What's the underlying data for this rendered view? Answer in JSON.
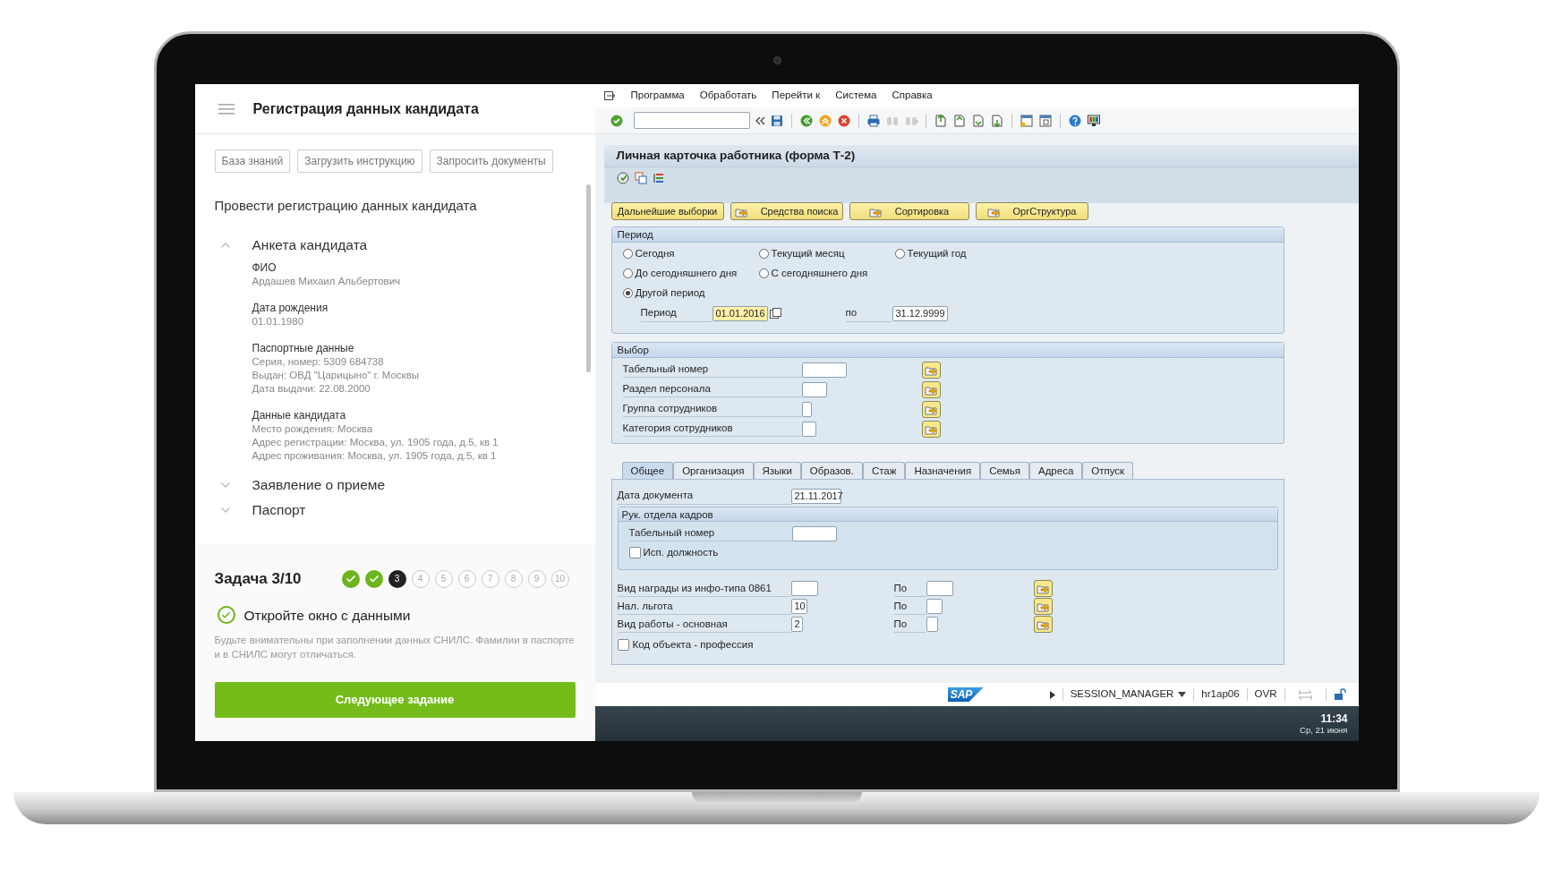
{
  "assistant": {
    "title": "Регистрация данных кандидата",
    "actions": [
      "База знаний",
      "Загрузить инструкцию",
      "Запросить документы"
    ],
    "task_heading": "Провести регистрацию данных кандидата",
    "sections": [
      {
        "title": "Анкета кандидата",
        "expanded": true,
        "fields": [
          {
            "label": "ФИО",
            "lines": [
              "Ардашев Михаил Альбертович"
            ]
          },
          {
            "label": "Дата рождения",
            "lines": [
              "01.01.1980"
            ]
          },
          {
            "label": "Паспортные данные",
            "lines": [
              "Серия, номер: 5309 684738",
              "Выдан: ОВД \"Царицыно\" г. Москвы",
              "Дата выдачи: 22.08.2000"
            ]
          },
          {
            "label": "Данные кандидата",
            "lines": [
              "Место рождения: Москва",
              "Адрес регистрации: Москва, ул. 1905 года, д.5, кв 1",
              "Адрес проживания: Москва, ул. 1905 года, д.5, кв 1"
            ]
          }
        ]
      },
      {
        "title": "Заявление о приеме",
        "expanded": false
      },
      {
        "title": "Паспорт",
        "expanded": false
      }
    ],
    "progress": {
      "label": "Задача 3/10",
      "steps": [
        {
          "done": true,
          "current": false
        },
        {
          "done": true,
          "current": false
        },
        {
          "label": "3",
          "done": false,
          "current": true
        },
        {
          "label": "4",
          "done": false,
          "current": false
        },
        {
          "label": "5",
          "done": false,
          "current": false
        },
        {
          "label": "6",
          "done": false,
          "current": false
        },
        {
          "label": "7",
          "done": false,
          "current": false
        },
        {
          "label": "8",
          "done": false,
          "current": false
        },
        {
          "label": "9",
          "done": false,
          "current": false
        },
        {
          "label": "10",
          "done": false,
          "current": false
        }
      ]
    },
    "hint": {
      "text": "Откройте окно с данными",
      "done": true
    },
    "note": "Будьте внимательны при заполнении данных СНИЛС. Фамилии в паспорте и в СНИЛС могут отличаться.",
    "next_button": "Следующее задание"
  },
  "sap": {
    "menu": [
      "Программа",
      "Обработать",
      "Перейти к",
      "Система",
      "Справка"
    ],
    "title": "Личная карточка работника (форма Т-2)",
    "buttons": [
      {
        "label": "Дальнейшие выборки",
        "kind": "plain"
      },
      {
        "label": "Средства поиска",
        "kind": "icon"
      },
      {
        "label": "Сортировка",
        "kind": "icon"
      },
      {
        "label": "ОргСтруктура",
        "kind": "icon"
      }
    ],
    "period": {
      "title": "Период",
      "option_rows": [
        [
          {
            "label": "Сегодня",
            "selected": false
          },
          {
            "label": "Текущий месяц",
            "selected": false
          },
          {
            "label": "Текущий год",
            "selected": false
          }
        ],
        [
          {
            "label": "До сегодняшнего дня",
            "selected": false
          },
          {
            "label": "С сегодняшнего дня",
            "selected": false
          }
        ],
        [
          {
            "label": "Другой период",
            "selected": true
          }
        ]
      ],
      "range": {
        "label": "Период",
        "from": "01.01.2016",
        "to_label": "по",
        "to": "31.12.9999"
      }
    },
    "selection": {
      "title": "Выбор",
      "rows": [
        {
          "label": "Табельный номер"
        },
        {
          "label": "Раздел персонала"
        },
        {
          "label": "Группа сотрудников"
        },
        {
          "label": "Категория сотрудников"
        }
      ]
    },
    "tabs": [
      {
        "label": "Общее",
        "selected": true
      },
      {
        "label": "Организация",
        "selected": false
      },
      {
        "label": "Языки",
        "selected": false
      },
      {
        "label": "Образов.",
        "selected": false
      },
      {
        "label": "Стаж",
        "selected": false
      },
      {
        "label": "Назначения",
        "selected": false
      },
      {
        "label": "Семья",
        "selected": false
      },
      {
        "label": "Адреса",
        "selected": false
      },
      {
        "label": "Отпуск",
        "selected": false
      }
    ],
    "general": {
      "doc_date": {
        "label": "Дата документа",
        "value": "21.11.2017"
      },
      "hr_head": {
        "title": "Рук. отдела кадров",
        "field_label": "Табельный номер",
        "checkbox": {
          "label": "Исп. должность",
          "checked": false
        }
      },
      "ranges": [
        {
          "label": "Вид награды из инфо-типа 0861",
          "to_label": "По"
        },
        {
          "label": "Нал. льгота",
          "value": "10",
          "to_label": "По"
        },
        {
          "label": "Вид работы - основная",
          "value": "2",
          "to_label": "По"
        }
      ],
      "checkbox": {
        "label": "Код объекта - профессия",
        "checked": false
      }
    },
    "status": {
      "logo": "SAP",
      "session": "SESSION_MANAGER",
      "server": "hr1ap06",
      "mode": "OVR"
    },
    "taskbar": {
      "time": "11:34",
      "date": "Ср, 21 июня"
    }
  }
}
